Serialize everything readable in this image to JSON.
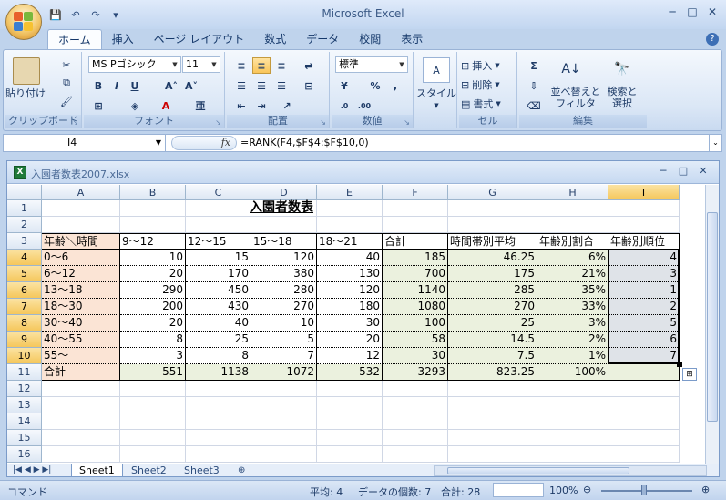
{
  "app": {
    "title": "Microsoft Excel"
  },
  "qat": {
    "save": "💾",
    "undo": "↶",
    "redo": "↷",
    "more": "▾"
  },
  "tabs": [
    "ホーム",
    "挿入",
    "ページ レイアウト",
    "数式",
    "データ",
    "校閲",
    "表示"
  ],
  "ribbon": {
    "clipboard": {
      "label": "クリップボード",
      "paste": "貼り付け"
    },
    "font": {
      "label": "フォント",
      "name": "MS Pゴシック",
      "size": "11"
    },
    "alignment": {
      "label": "配置"
    },
    "number": {
      "label": "数値",
      "format": "標準"
    },
    "style": {
      "label": "スタイル"
    },
    "cells": {
      "label": "セル",
      "insert": "挿入",
      "delete": "削除",
      "format": "書式"
    },
    "editing": {
      "label": "編集",
      "sort": "並べ替えと\nフィルタ",
      "find": "検索と\n選択"
    }
  },
  "formula": {
    "namebox": "I4",
    "fx": "fx",
    "text": "=RANK(F4,$F$4:$F$10,0)"
  },
  "workbook": {
    "title": "入園者数表2007.xlsx"
  },
  "columns": [
    "A",
    "B",
    "C",
    "D",
    "E",
    "F",
    "G",
    "H",
    "I"
  ],
  "rows": [
    "1",
    "2",
    "3",
    "4",
    "5",
    "6",
    "7",
    "8",
    "9",
    "10",
    "11",
    "12",
    "13",
    "14",
    "15",
    "16"
  ],
  "table": {
    "title": "入園者数表",
    "headers": [
      "年齢＼時間",
      "9〜12",
      "12〜15",
      "15〜18",
      "18〜21",
      "合計",
      "時間帯別平均",
      "年齢別割合",
      "年齢別順位"
    ],
    "data": [
      [
        "0〜6",
        "10",
        "15",
        "120",
        "40",
        "185",
        "46.25",
        "6%",
        "4"
      ],
      [
        "6〜12",
        "20",
        "170",
        "380",
        "130",
        "700",
        "175",
        "21%",
        "3"
      ],
      [
        "13〜18",
        "290",
        "450",
        "280",
        "120",
        "1140",
        "285",
        "35%",
        "1"
      ],
      [
        "18〜30",
        "200",
        "430",
        "270",
        "180",
        "1080",
        "270",
        "33%",
        "2"
      ],
      [
        "30〜40",
        "20",
        "40",
        "10",
        "30",
        "100",
        "25",
        "3%",
        "5"
      ],
      [
        "40〜55",
        "8",
        "25",
        "5",
        "20",
        "58",
        "14.5",
        "2%",
        "6"
      ],
      [
        "55〜",
        "3",
        "8",
        "7",
        "12",
        "30",
        "7.5",
        "1%",
        "7"
      ],
      [
        "合計",
        "551",
        "1138",
        "1072",
        "532",
        "3293",
        "823.25",
        "100%",
        ""
      ]
    ]
  },
  "sheets": [
    "Sheet1",
    "Sheet2",
    "Sheet3"
  ],
  "status": {
    "mode": "コマンド",
    "average": "平均: 4",
    "count": "データの個数: 7",
    "sum": "合計: 28",
    "zoom": "100%"
  }
}
